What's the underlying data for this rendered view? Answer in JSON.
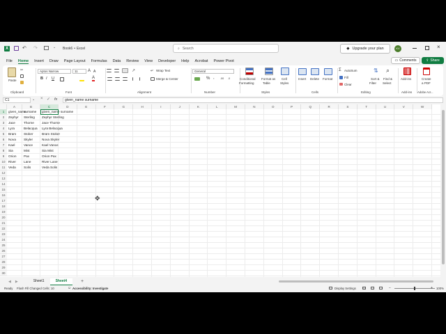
{
  "title": {
    "book": "Book6",
    "sep": "•",
    "app": "Excel",
    "search_placeholder": "Search",
    "upgrade": "Upgrade your plan",
    "avatar": "KV"
  },
  "menu": [
    {
      "label": "File"
    },
    {
      "label": "Home",
      "active": true
    },
    {
      "label": "Insert"
    },
    {
      "label": "Draw"
    },
    {
      "label": "Page Layout"
    },
    {
      "label": "Formulas"
    },
    {
      "label": "Data"
    },
    {
      "label": "Review"
    },
    {
      "label": "View"
    },
    {
      "label": "Developer"
    },
    {
      "label": "Help"
    },
    {
      "label": "Acrobat"
    },
    {
      "label": "Power Pivot"
    }
  ],
  "actions": {
    "comments": "Comments",
    "share": "Share"
  },
  "ribbon": {
    "paste": "Paste",
    "font_name": "Aptos Narrow",
    "font_size": "11",
    "wrap_text": "Wrap Text",
    "merge_center": "Merge & Center",
    "number_format": "General",
    "conditional": [
      "Conditional",
      "Formatting"
    ],
    "format_table": [
      "Format as",
      "Table"
    ],
    "cell_styles": [
      "Cell",
      "Styles"
    ],
    "insert": "Insert",
    "delete": "Delete",
    "format": "Format",
    "autosum": "AutoSum",
    "fill": "Fill",
    "clear": "Clear",
    "sort": [
      "Sort &",
      "Filter"
    ],
    "find": [
      "Find &",
      "Select"
    ],
    "addins": "Add-ins",
    "pdf": [
      "Create",
      "a PDF"
    ],
    "groups": {
      "clipboard": "Clipboard",
      "font": "Font",
      "alignment": "Alignment",
      "number": "Number",
      "styles": "Styles",
      "cells": "Cells",
      "editing": "Editing",
      "addins": "Add-ins",
      "acrobat": "Adobe Acr..."
    }
  },
  "formula": {
    "namebox": "C1",
    "fx": "fx",
    "content": "given_name surname"
  },
  "columns": [
    "A",
    "B",
    "C",
    "D",
    "E",
    "F",
    "G",
    "H",
    "I",
    "J",
    "K",
    "L",
    "M",
    "N",
    "O",
    "P",
    "Q",
    "R",
    "S",
    "T",
    "U",
    "V",
    "W"
  ],
  "rows": [
    [
      "given_name",
      "surname",
      "given_name surname"
    ],
    [
      "Zephyr",
      "Sterling",
      "Zephyr Sterling"
    ],
    [
      "Jace",
      "Thorne",
      "Jace Thorne"
    ],
    [
      "Lyra",
      "Belacqua",
      "Lyra Belacqua"
    ],
    [
      "Bram",
      "Stoker",
      "Bram Stoker"
    ],
    [
      "Nova",
      "Skyler",
      "Nova Skyler"
    ],
    [
      "Kael",
      "Vance",
      "Kael Vance"
    ],
    [
      "Sia",
      "Mist",
      "Sia Mist"
    ],
    [
      "Orion",
      "Pax",
      "Orion Pax"
    ],
    [
      "River",
      "Lane",
      "River Lane"
    ],
    [
      "Veda",
      "Solis",
      "Veda Solis"
    ]
  ],
  "row_count": 30,
  "sheets": [
    {
      "name": "Sheet1",
      "active": false
    },
    {
      "name": "Sheet4",
      "active": true
    }
  ],
  "status": {
    "ready": "Ready",
    "flash_fill": "Flash Fill Changed Cells: 10",
    "accessibility": "Accessibility: Investigate",
    "display": "Display Settings",
    "zoom": "100%"
  },
  "colors": {
    "accent": "#107c41"
  }
}
